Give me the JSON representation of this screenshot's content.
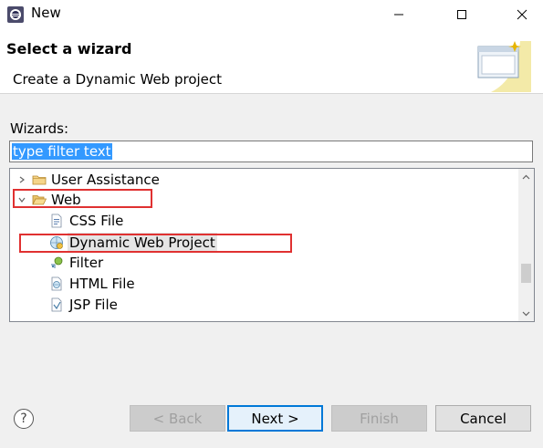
{
  "window": {
    "title": "New",
    "minimize_icon": "minimize-icon",
    "maximize_icon": "maximize-icon",
    "close_icon": "close-icon"
  },
  "header": {
    "title": "Select a wizard",
    "description": "Create a Dynamic Web project",
    "banner_icon": "new-wizard-banner-icon"
  },
  "wizards": {
    "label": "Wizards:",
    "filter_value": "type filter text",
    "tree": [
      {
        "label": "User Assistance",
        "expanded": false,
        "icon": "folder-icon"
      },
      {
        "label": "Web",
        "expanded": true,
        "icon": "folder-open-icon"
      },
      {
        "label": "CSS File",
        "icon": "css-file-icon"
      },
      {
        "label": "Dynamic Web Project",
        "icon": "dynamic-web-project-icon",
        "selected": true
      },
      {
        "label": "Filter",
        "icon": "filter-icon"
      },
      {
        "label": "HTML File",
        "icon": "html-file-icon"
      },
      {
        "label": "JSP File",
        "icon": "jsp-file-icon"
      }
    ]
  },
  "buttons": {
    "help": "?",
    "back": "< Back",
    "next": "Next >",
    "finish": "Finish",
    "cancel": "Cancel"
  },
  "colors": {
    "highlight": "#e03131",
    "selection": "#3399ff",
    "default_button_border": "#0078d7"
  }
}
